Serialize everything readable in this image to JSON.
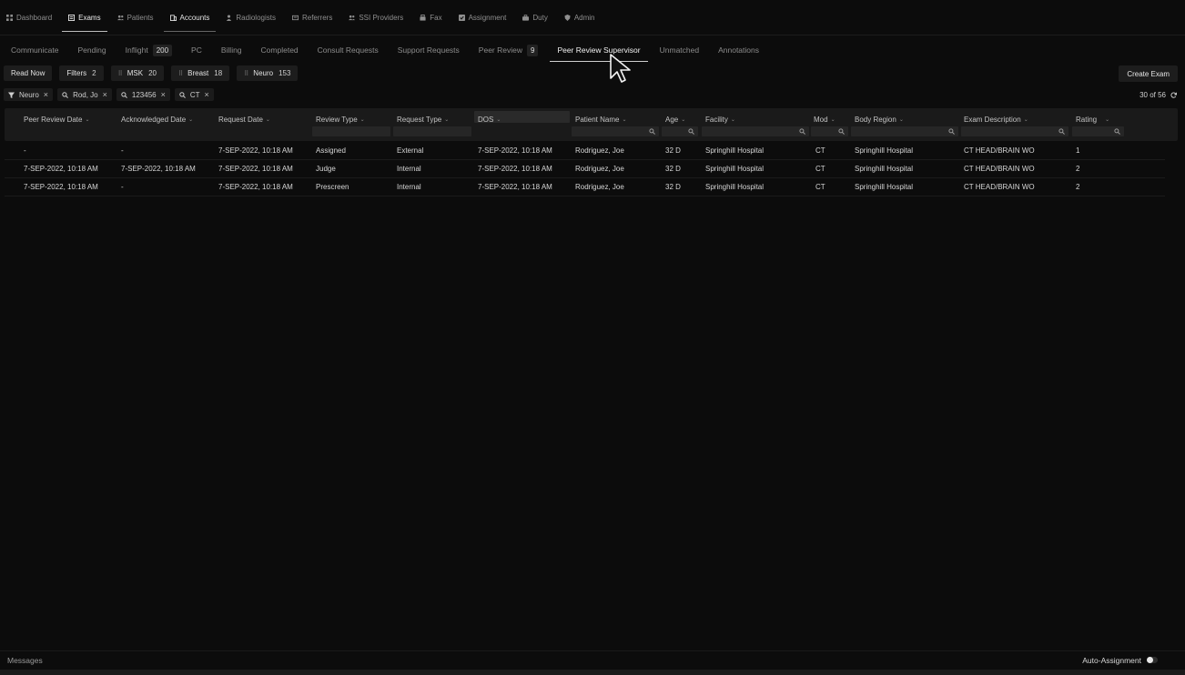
{
  "nav": {
    "items": [
      {
        "label": "Dashboard",
        "icon": "grid-icon"
      },
      {
        "label": "Exams",
        "icon": "exam-icon"
      },
      {
        "label": "Patients",
        "icon": "people-icon"
      },
      {
        "label": "Accounts",
        "icon": "building-icon"
      },
      {
        "label": "Radiologists",
        "icon": "person-icon"
      },
      {
        "label": "Referrers",
        "icon": "card-icon"
      },
      {
        "label": "SSI Providers",
        "icon": "people-icon"
      },
      {
        "label": "Fax",
        "icon": "fax-icon"
      },
      {
        "label": "Assignment",
        "icon": "checkbox-icon"
      },
      {
        "label": "Duty",
        "icon": "briefcase-icon"
      },
      {
        "label": "Admin",
        "icon": "shield-icon"
      }
    ],
    "active": "Exams"
  },
  "subtabs": [
    {
      "label": "Communicate"
    },
    {
      "label": "Pending"
    },
    {
      "label": "Inflight",
      "badge": "200"
    },
    {
      "label": "PC"
    },
    {
      "label": "Billing"
    },
    {
      "label": "Completed"
    },
    {
      "label": "Consult Requests"
    },
    {
      "label": "Support Requests"
    },
    {
      "label": "Peer Review",
      "badge": "9"
    },
    {
      "label": "Peer Review Supervisor"
    },
    {
      "label": "Unmatched"
    },
    {
      "label": "Annotations"
    }
  ],
  "active_subtab": "Peer Review Supervisor",
  "actions": {
    "read_now": "Read Now",
    "filters_label": "Filters",
    "filters_count": "2",
    "presets": [
      {
        "label": "MSK",
        "count": "20"
      },
      {
        "label": "Breast",
        "count": "18"
      },
      {
        "label": "Neuro",
        "count": "153"
      }
    ],
    "create_exam": "Create Exam"
  },
  "chips": [
    {
      "label": "Neuro",
      "icon": "filter-icon"
    },
    {
      "label": "Rod, Jo",
      "icon": "search-icon"
    },
    {
      "label": "123456",
      "icon": "search-icon"
    },
    {
      "label": "CT",
      "icon": "search-icon"
    }
  ],
  "pagination": {
    "text": "30 of 56"
  },
  "table": {
    "columns": [
      {
        "label": "Peer Review Date",
        "filter": false
      },
      {
        "label": "Acknowledged Date",
        "filter": false
      },
      {
        "label": "Request Date",
        "filter": false
      },
      {
        "label": "Review Type",
        "filter": true
      },
      {
        "label": "Request Type",
        "filter": true
      },
      {
        "label": "DOS",
        "filter": false
      },
      {
        "label": "Patient Name",
        "filter": true
      },
      {
        "label": "Age",
        "filter": true
      },
      {
        "label": "Facility",
        "filter": true
      },
      {
        "label": "Mod",
        "filter": true
      },
      {
        "label": "Body Region",
        "filter": true
      },
      {
        "label": "Exam Description",
        "filter": true
      },
      {
        "label": "Rating",
        "filter": true
      }
    ],
    "rows": [
      [
        "-",
        "-",
        "7-SEP-2022, 10:18 AM",
        "Assigned",
        "External",
        "7-SEP-2022, 10:18 AM",
        "Rodriguez, Joe",
        "32 D",
        "Springhill Hospital",
        "CT",
        "Springhill Hospital",
        "CT HEAD/BRAIN WO",
        "1"
      ],
      [
        "7-SEP-2022, 10:18 AM",
        "7-SEP-2022, 10:18 AM",
        "7-SEP-2022, 10:18 AM",
        "Judge",
        "Internal",
        "7-SEP-2022, 10:18 AM",
        "Rodriguez, Joe",
        "32 D",
        "Springhill Hospital",
        "CT",
        "Springhill Hospital",
        "CT HEAD/BRAIN WO",
        "2"
      ],
      [
        "7-SEP-2022, 10:18 AM",
        "-",
        "7-SEP-2022, 10:18 AM",
        "Prescreen",
        "Internal",
        "7-SEP-2022, 10:18 AM",
        "Rodriguez, Joe",
        "32 D",
        "Springhill Hospital",
        "CT",
        "Springhill Hospital",
        "CT HEAD/BRAIN WO",
        "2"
      ]
    ]
  },
  "footer": {
    "messages": "Messages",
    "auto_assignment": "Auto-Assignment"
  },
  "colors": {
    "background": "#0c0c0c",
    "header_bg": "#1a1a1a",
    "chip_bg": "#1b1b1b",
    "text": "#d2d2d2"
  }
}
